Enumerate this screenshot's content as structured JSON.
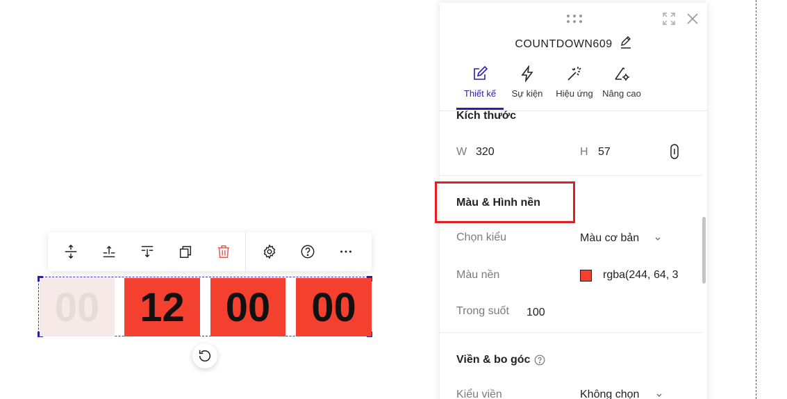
{
  "panel": {
    "title": "COUNTDOWN609",
    "tabs": [
      {
        "label": "Thiết kế",
        "icon": "edit-icon",
        "active": true
      },
      {
        "label": "Sự kiện",
        "icon": "lightning-icon"
      },
      {
        "label": "Hiệu ứng",
        "icon": "magic-wand-icon"
      },
      {
        "label": "Nâng cao",
        "icon": "advanced-settings-icon"
      }
    ],
    "size_section": {
      "title": "Kích thước",
      "width_label": "W",
      "width_value": "320",
      "height_label": "H",
      "height_value": "57"
    },
    "background_section": {
      "title": "Màu & Hình nền",
      "style_label": "Chọn kiểu",
      "style_value": "Màu cơ bản",
      "bgcolor_label": "Màu nền",
      "bgcolor_value": "rgba(244, 64, 3",
      "opacity_label": "Trong suốt",
      "opacity_value": "100"
    },
    "border_section": {
      "title": "Viền & bo góc",
      "border_style_label": "Kiểu viền",
      "border_style_value": "Không chọn"
    }
  },
  "countdown": {
    "segments": [
      "00",
      "12",
      "00",
      "00"
    ],
    "color": "#f4402f"
  },
  "toolbar": {
    "icons": [
      "align-vertical-icon",
      "move-up-icon",
      "move-down-icon",
      "duplicate-icon",
      "delete-icon",
      "settings-icon",
      "help-icon",
      "more-icon"
    ]
  },
  "colors": {
    "accent": "#2a1fa8",
    "highlight": "#e02020"
  }
}
